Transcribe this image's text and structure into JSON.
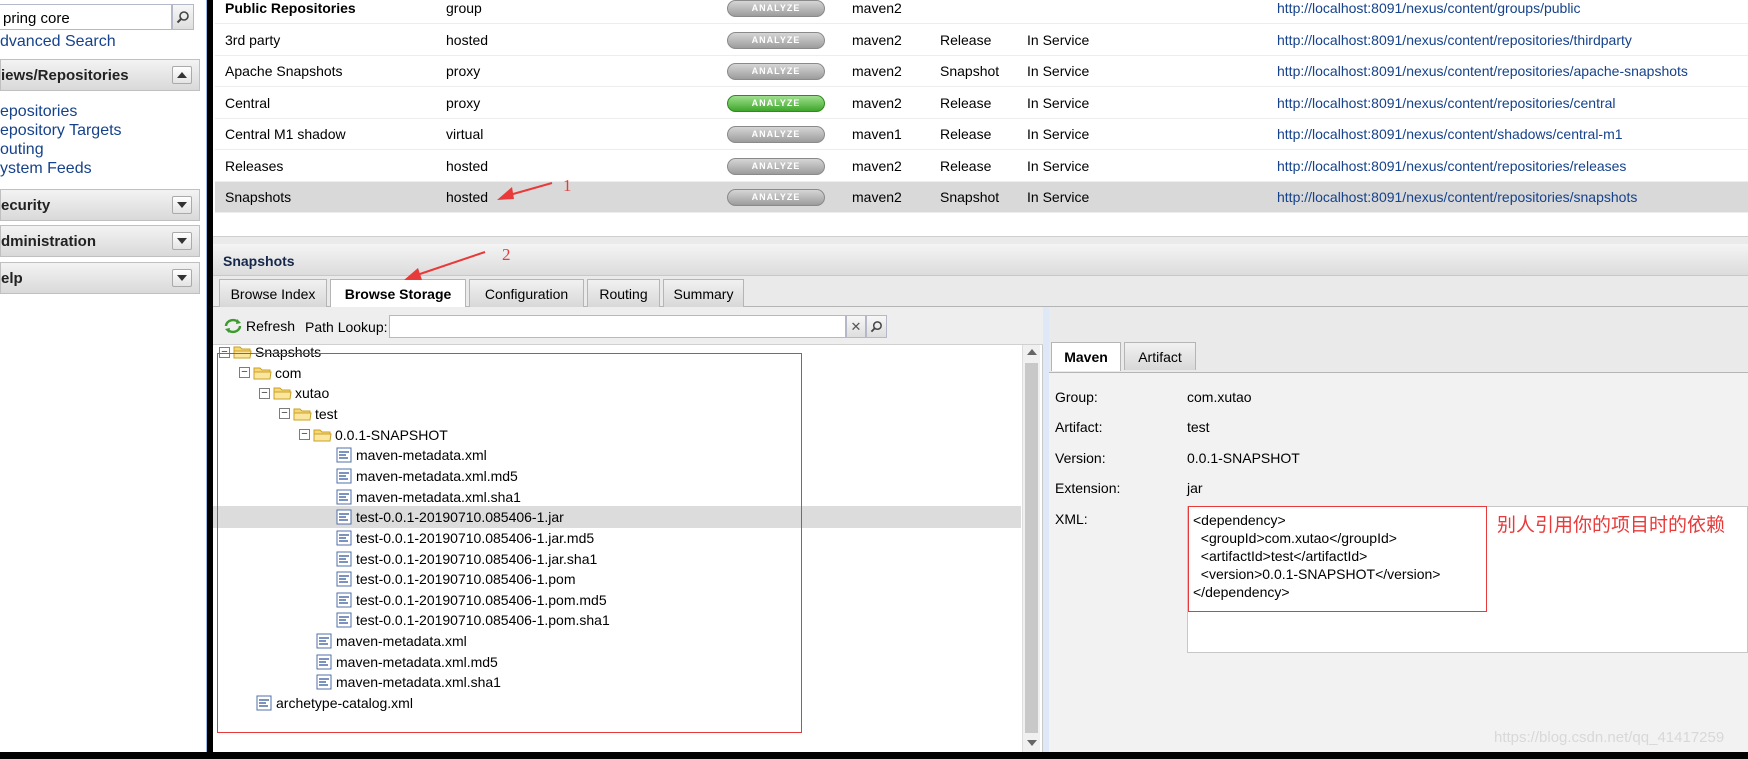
{
  "sidebar": {
    "search_value": "pring core",
    "advanced_search": "dvanced Search",
    "panels": [
      {
        "label": "iews/Repositories"
      },
      {
        "label": "ecurity"
      },
      {
        "label": "dministration"
      },
      {
        "label": "elp"
      }
    ],
    "links": [
      "epositories",
      "epository Targets",
      "outing",
      "ystem Feeds"
    ]
  },
  "grid": {
    "analyze_label": "ANALYZE",
    "rows": [
      {
        "name": "Public Repositories",
        "type": "group",
        "format": "maven2",
        "policy": "",
        "status": "",
        "url": "http://localhost:8091/nexus/content/groups/public",
        "analyze_active": false,
        "bold": true
      },
      {
        "name": "3rd party",
        "type": "hosted",
        "format": "maven2",
        "policy": "Release",
        "status": "In Service",
        "url": "http://localhost:8091/nexus/content/repositories/thirdparty",
        "analyze_active": false
      },
      {
        "name": "Apache Snapshots",
        "type": "proxy",
        "format": "maven2",
        "policy": "Snapshot",
        "status": "In Service",
        "url": "http://localhost:8091/nexus/content/repositories/apache-snapshots",
        "analyze_active": false
      },
      {
        "name": "Central",
        "type": "proxy",
        "format": "maven2",
        "policy": "Release",
        "status": "In Service",
        "url": "http://localhost:8091/nexus/content/repositories/central",
        "analyze_active": true
      },
      {
        "name": "Central M1 shadow",
        "type": "virtual",
        "format": "maven1",
        "policy": "Release",
        "status": "In Service",
        "url": "http://localhost:8091/nexus/content/shadows/central-m1",
        "analyze_active": false
      },
      {
        "name": "Releases",
        "type": "hosted",
        "format": "maven2",
        "policy": "Release",
        "status": "In Service",
        "url": "http://localhost:8091/nexus/content/repositories/releases",
        "analyze_active": false
      },
      {
        "name": "Snapshots",
        "type": "hosted",
        "format": "maven2",
        "policy": "Snapshot",
        "status": "In Service",
        "url": "http://localhost:8091/nexus/content/repositories/snapshots",
        "analyze_active": false,
        "selected": true
      }
    ]
  },
  "detail": {
    "title": "Snapshots",
    "tabs": [
      "Browse Index",
      "Browse Storage",
      "Configuration",
      "Routing",
      "Summary"
    ],
    "active_tab": "Browse Storage"
  },
  "storage": {
    "refresh_label": "Refresh",
    "path_label": "Path Lookup:",
    "path_value": "",
    "tree": [
      {
        "label": "Snapshots",
        "kind": "folder",
        "level": 0,
        "toggle": "−"
      },
      {
        "label": "com",
        "kind": "folder",
        "level": 1,
        "toggle": "−"
      },
      {
        "label": "xutao",
        "kind": "folder",
        "level": 2,
        "toggle": "−"
      },
      {
        "label": "test",
        "kind": "folder",
        "level": 3,
        "toggle": "−"
      },
      {
        "label": "0.0.1-SNAPSHOT",
        "kind": "folder",
        "level": 4,
        "toggle": "−"
      },
      {
        "label": "maven-metadata.xml",
        "kind": "file",
        "level": 5
      },
      {
        "label": "maven-metadata.xml.md5",
        "kind": "file",
        "level": 5
      },
      {
        "label": "maven-metadata.xml.sha1",
        "kind": "file",
        "level": 5
      },
      {
        "label": "test-0.0.1-20190710.085406-1.jar",
        "kind": "file",
        "level": 5,
        "selected": true
      },
      {
        "label": "test-0.0.1-20190710.085406-1.jar.md5",
        "kind": "file",
        "level": 5
      },
      {
        "label": "test-0.0.1-20190710.085406-1.jar.sha1",
        "kind": "file",
        "level": 5
      },
      {
        "label": "test-0.0.1-20190710.085406-1.pom",
        "kind": "file",
        "level": 5
      },
      {
        "label": "test-0.0.1-20190710.085406-1.pom.md5",
        "kind": "file",
        "level": 5
      },
      {
        "label": "test-0.0.1-20190710.085406-1.pom.sha1",
        "kind": "file",
        "level": 5
      },
      {
        "label": "maven-metadata.xml",
        "kind": "file",
        "level": 4
      },
      {
        "label": "maven-metadata.xml.md5",
        "kind": "file",
        "level": 4
      },
      {
        "label": "maven-metadata.xml.sha1",
        "kind": "file",
        "level": 4
      },
      {
        "label": "archetype-catalog.xml",
        "kind": "file",
        "level": 2
      }
    ]
  },
  "artifact": {
    "tabs": [
      "Maven",
      "Artifact"
    ],
    "active_tab": "Maven",
    "fields": [
      {
        "label": "Group:",
        "value": "com.xutao"
      },
      {
        "label": "Artifact:",
        "value": "test"
      },
      {
        "label": "Version:",
        "value": "0.0.1-SNAPSHOT"
      },
      {
        "label": "Extension:",
        "value": "jar"
      }
    ],
    "xml_label": "XML:",
    "xml": "<dependency>\n  <groupId>com.xutao</groupId>\n  <artifactId>test</artifactId>\n  <version>0.0.1-SNAPSHOT</version>\n</dependency>"
  },
  "annotations": {
    "marker_1": "1",
    "marker_2": "2",
    "note_cn": "别人引用你的项目时的依赖",
    "watermark": "https://blog.csdn.net/qq_41417259",
    "red": "#e83a3a"
  },
  "colors": {
    "link": "#15428b",
    "selected_row": "#d9d9d9",
    "analyze_active": "#3ea72a",
    "analyze_inactive": "#9c9c9c"
  }
}
